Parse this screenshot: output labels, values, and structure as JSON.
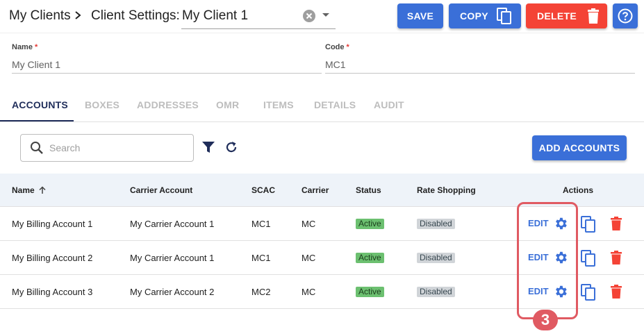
{
  "header": {
    "breadcrumb_root": "My Clients",
    "breadcrumb_sep": "›",
    "page_title": "Client Settings:",
    "client_value": "My Client 1",
    "save_label": "SAVE",
    "copy_label": "COPY",
    "delete_label": "DELETE"
  },
  "form": {
    "name_label": "Name",
    "name_required": "*",
    "name_value": "My Client 1",
    "code_label": "Code",
    "code_required": "*",
    "code_value": "MC1"
  },
  "tabs": [
    {
      "label": "ACCOUNTS",
      "active": true
    },
    {
      "label": "BOXES"
    },
    {
      "label": "ADDRESSES"
    },
    {
      "label": "OMR"
    },
    {
      "label": "ITEMS"
    },
    {
      "label": "DETAILS"
    },
    {
      "label": "AUDIT"
    }
  ],
  "toolbar": {
    "search_placeholder": "Search",
    "add_label": "ADD ACCOUNTS"
  },
  "table": {
    "columns": [
      "Name",
      "Carrier Account",
      "SCAC",
      "Carrier",
      "Status",
      "Rate Shopping",
      "Actions"
    ],
    "rows": [
      {
        "name": "My Billing Account 1",
        "carrier_account": "My Carrier Account 1",
        "scac": "MC1",
        "carrier": "MC",
        "status": "Active",
        "rate_shopping": "Disabled",
        "edit": "EDIT"
      },
      {
        "name": "My Billing Account 2",
        "carrier_account": "My Carrier Account 1",
        "scac": "MC1",
        "carrier": "MC",
        "status": "Active",
        "rate_shopping": "Disabled",
        "edit": "EDIT"
      },
      {
        "name": "My Billing Account 3",
        "carrier_account": "My Carrier Account 2",
        "scac": "MC2",
        "carrier": "MC",
        "status": "Active",
        "rate_shopping": "Disabled",
        "edit": "EDIT"
      }
    ]
  },
  "callout": {
    "number": "3"
  },
  "colors": {
    "primary": "#3a6fd8",
    "danger": "#f44336",
    "tab_active": "#1f2d5a",
    "callout": "#e05a62",
    "badge_active": "#6cc070",
    "badge_disabled": "#d0d4d8"
  }
}
